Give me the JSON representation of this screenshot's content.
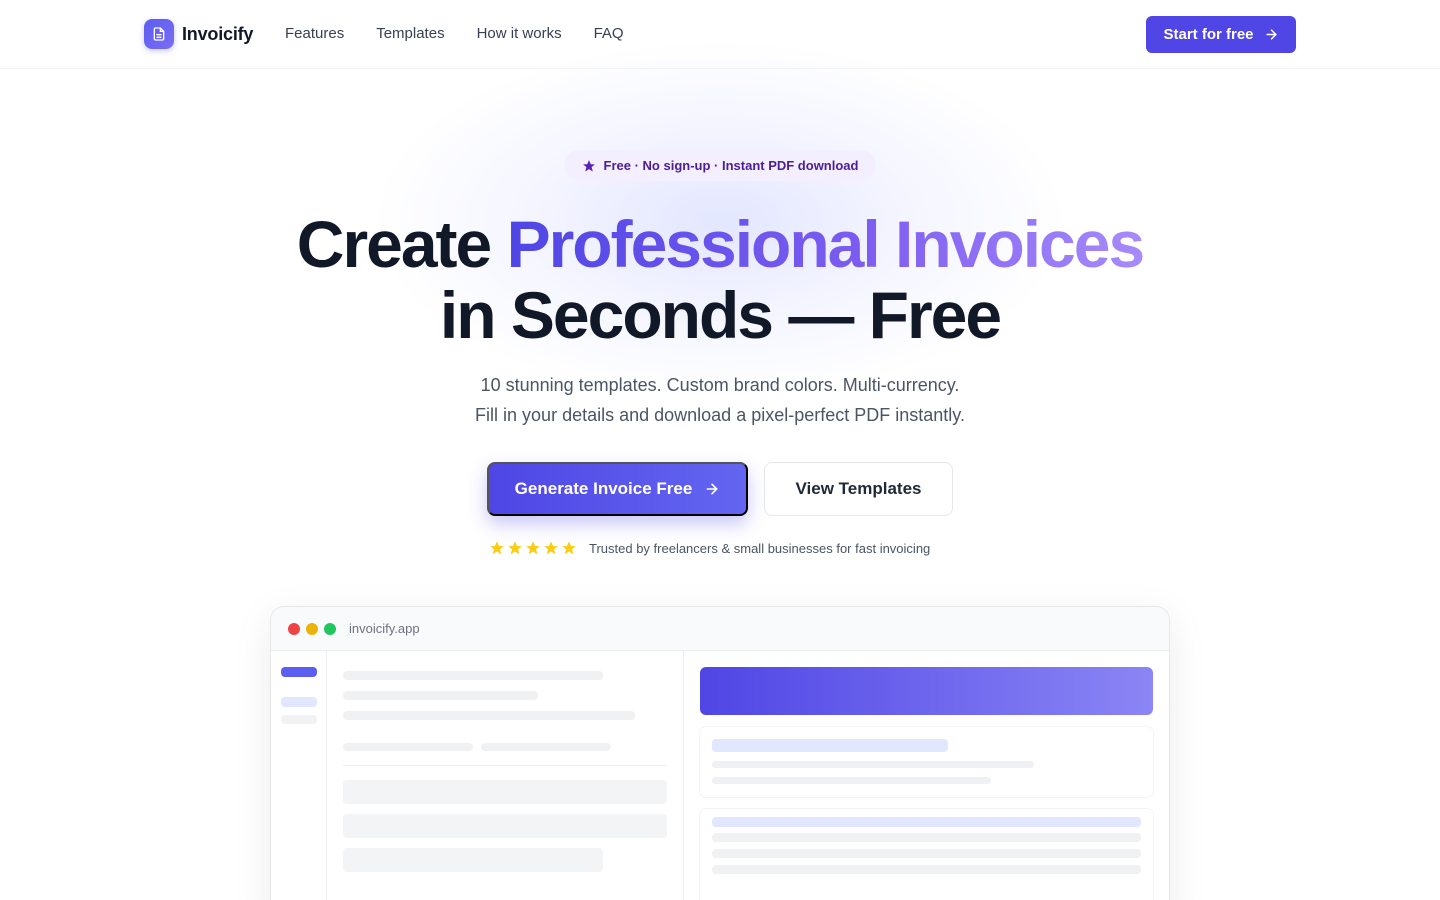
{
  "nav": {
    "brand": "Invoicify",
    "links": [
      "Features",
      "Templates",
      "How it works",
      "FAQ"
    ],
    "cta": "Start for free"
  },
  "hero": {
    "badge": "Free · No sign-up · Instant PDF download",
    "title_part1": "Create ",
    "title_highlight": "Professional Invoices",
    "title_line2": "in Seconds — Free",
    "subtitle_line1": "10 stunning templates. Custom brand colors. Multi-currency.",
    "subtitle_line2": "Fill in your details and download a pixel-perfect PDF instantly.",
    "primary_button": "Generate Invoice Free",
    "secondary_button": "View Templates",
    "rating_stars": 5,
    "trust_text": "Trusted by freelancers & small businesses for fast invoicing"
  },
  "preview": {
    "url": "invoicify.app"
  },
  "colors": {
    "accent": "#4f46e5",
    "accent_light": "#8b85f5",
    "star": "#facc15",
    "dot_red": "#ef4444",
    "dot_yellow": "#eab308",
    "dot_green": "#22c55e"
  }
}
